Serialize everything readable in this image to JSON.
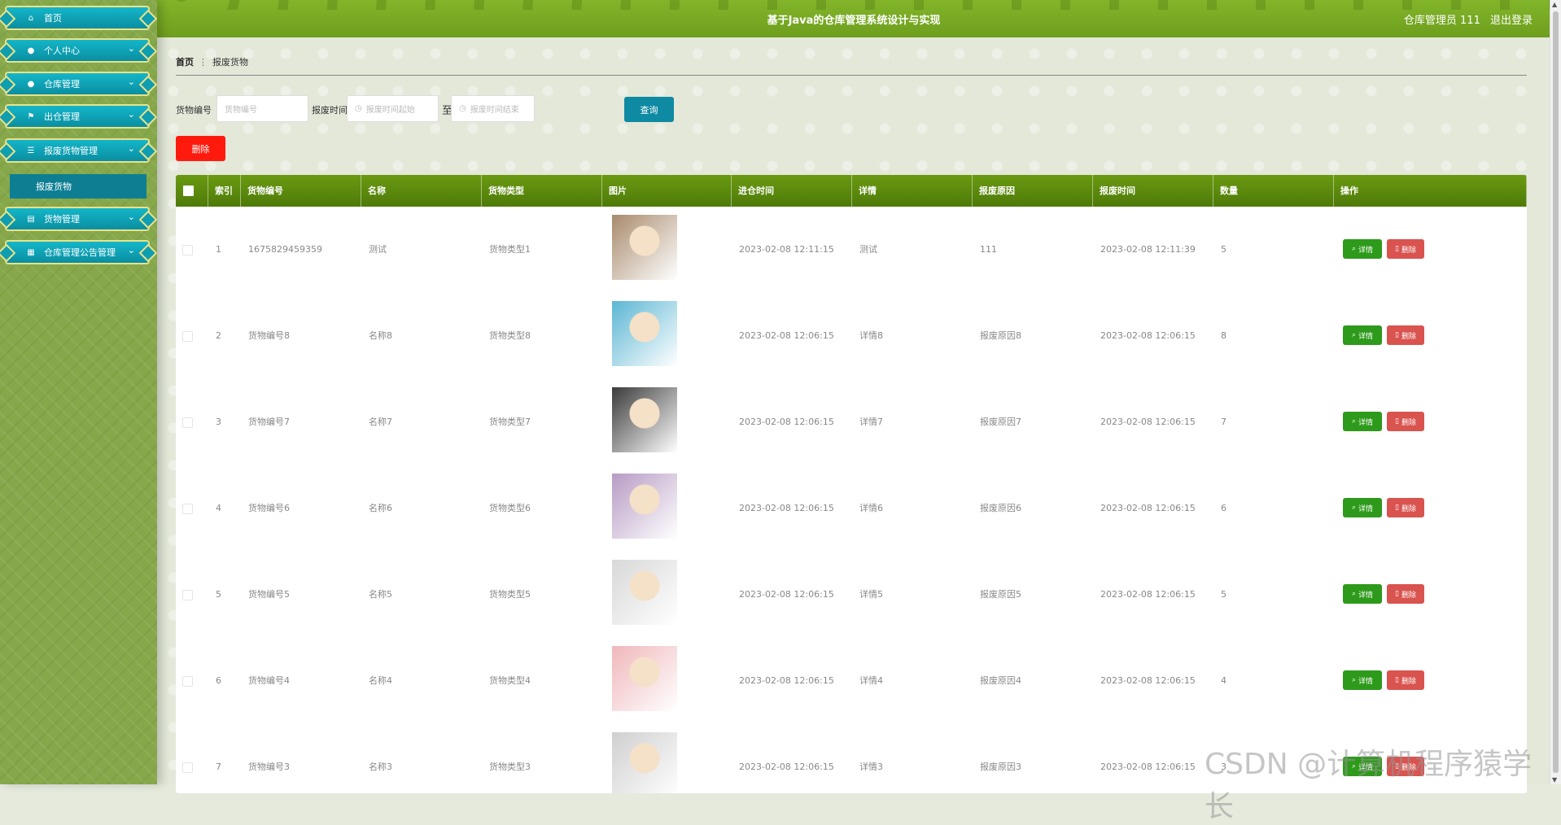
{
  "app": {
    "title": "基于Java的仓库管理系统设计与实现",
    "user_label": "仓库管理员 111",
    "logout_label": "退出登录"
  },
  "sidebar": {
    "items": [
      {
        "label": "首页",
        "icon": "home-icon",
        "glyph": "⌂",
        "expandable": false
      },
      {
        "label": "个人中心",
        "icon": "user-icon",
        "glyph": "●",
        "expandable": true
      },
      {
        "label": "仓库管理",
        "icon": "user-icon",
        "glyph": "●",
        "expandable": true
      },
      {
        "label": "出仓管理",
        "icon": "flag-icon",
        "glyph": "⚑",
        "expandable": true
      },
      {
        "label": "报废货物管理",
        "icon": "list-icon",
        "glyph": "☰",
        "expandable": true
      },
      {
        "label": "货物管理",
        "icon": "clipboard-icon",
        "glyph": "▤",
        "expandable": true
      },
      {
        "label": "仓库管理公告管理",
        "icon": "grid-icon",
        "glyph": "▦",
        "expandable": true
      }
    ],
    "submenu_active": "报废货物"
  },
  "breadcrumb": {
    "home": "首页",
    "current": "报废货物"
  },
  "search": {
    "goods_no_label": "货物编号",
    "goods_no_placeholder": "货物编号",
    "scrap_time_label": "报废时间",
    "start_placeholder": "报废时间起始",
    "to_label": "至",
    "end_placeholder": "报废时间结束",
    "query_label": "查询"
  },
  "bulk_delete_label": "删除",
  "table": {
    "columns": [
      "索引",
      "货物编号",
      "名称",
      "货物类型",
      "图片",
      "进仓时间",
      "详情",
      "报废原因",
      "报废时间",
      "数量",
      "操作"
    ],
    "detail_label": "详情",
    "delete_label": "删除",
    "rows": [
      {
        "index": "1",
        "goods_no": "1675829459359",
        "name": "测试",
        "type": "货物类型1",
        "in_time": "2023-02-08 12:11:15",
        "detail": "测试",
        "reason": "111",
        "scrap_time": "2023-02-08 12:11:39",
        "qty": "5",
        "img_color": "#a88a6c"
      },
      {
        "index": "2",
        "goods_no": "货物编号8",
        "name": "名称8",
        "type": "货物类型8",
        "in_time": "2023-02-08 12:06:15",
        "detail": "详情8",
        "reason": "报废原因8",
        "scrap_time": "2023-02-08 12:06:15",
        "qty": "8",
        "img_color": "#5bb6d4"
      },
      {
        "index": "3",
        "goods_no": "货物编号7",
        "name": "名称7",
        "type": "货物类型7",
        "in_time": "2023-02-08 12:06:15",
        "detail": "详情7",
        "reason": "报废原因7",
        "scrap_time": "2023-02-08 12:06:15",
        "qty": "7",
        "img_color": "#3a3a3a"
      },
      {
        "index": "4",
        "goods_no": "货物编号6",
        "name": "名称6",
        "type": "货物类型6",
        "in_time": "2023-02-08 12:06:15",
        "detail": "详情6",
        "reason": "报废原因6",
        "scrap_time": "2023-02-08 12:06:15",
        "qty": "6",
        "img_color": "#b79bc4"
      },
      {
        "index": "5",
        "goods_no": "货物编号5",
        "name": "名称5",
        "type": "货物类型5",
        "in_time": "2023-02-08 12:06:15",
        "detail": "详情5",
        "reason": "报废原因5",
        "scrap_time": "2023-02-08 12:06:15",
        "qty": "5",
        "img_color": "#d8d8d8"
      },
      {
        "index": "6",
        "goods_no": "货物编号4",
        "name": "名称4",
        "type": "货物类型4",
        "in_time": "2023-02-08 12:06:15",
        "detail": "详情4",
        "reason": "报废原因4",
        "scrap_time": "2023-02-08 12:06:15",
        "qty": "4",
        "img_color": "#f0b7bb"
      },
      {
        "index": "7",
        "goods_no": "货物编号3",
        "name": "名称3",
        "type": "货物类型3",
        "in_time": "2023-02-08 12:06:15",
        "detail": "详情3",
        "reason": "报废原因3",
        "scrap_time": "2023-02-08 12:06:15",
        "qty": "3",
        "img_color": "#cfcfcf"
      }
    ]
  },
  "watermark": "CSDN @计算机程序猿学长",
  "colors": {
    "header_green": "#76a823",
    "menu_teal": "#0f9db0",
    "menu_border": "#e9e28a",
    "query_blue": "#0f8aa3",
    "delete_red": "#ff1a0d",
    "detail_green": "#2e9a1b",
    "row_delete_red": "#d9534f"
  }
}
